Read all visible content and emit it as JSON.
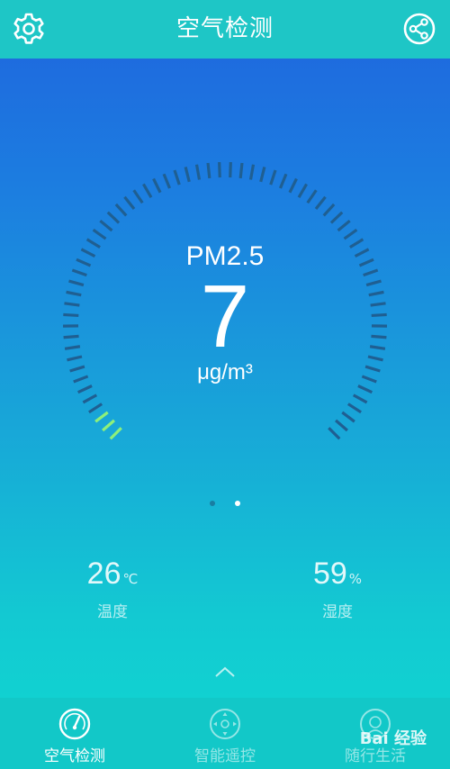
{
  "header": {
    "title": "空气检测",
    "left_icon": "gear-icon",
    "right_icon": "share-icon"
  },
  "gauge": {
    "label": "PM2.5",
    "value": "7",
    "unit": "μg/m³",
    "colors": {
      "track": "#1f5f92",
      "active": "#8ef07a"
    },
    "level_fraction": 0.05
  },
  "pager": {
    "current_page": 2,
    "total_pages": 2
  },
  "stats": {
    "temperature": {
      "value": "26",
      "unit": "℃",
      "label": "温度"
    },
    "humidity": {
      "value": "59",
      "unit": "%",
      "label": "湿度"
    }
  },
  "bottom_nav": {
    "items": [
      {
        "label": "空气检测",
        "icon": "gauge-icon",
        "active": true
      },
      {
        "label": "智能遥控",
        "icon": "remote-control-icon",
        "active": false
      },
      {
        "label": "随行生活",
        "icon": "lifestyle-icon",
        "active": false
      }
    ]
  },
  "watermark": {
    "text": "Bai 经验"
  }
}
